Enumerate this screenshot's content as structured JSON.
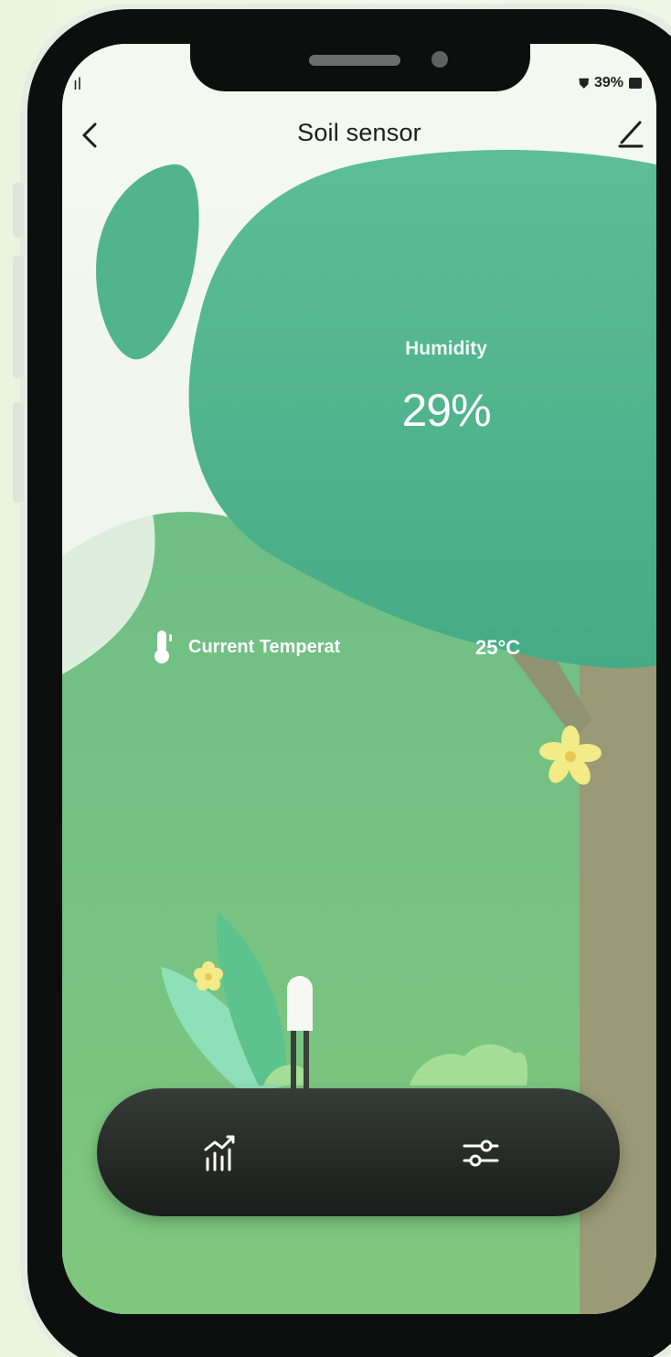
{
  "status_bar": {
    "signal": "ıl",
    "battery_text": "39%"
  },
  "header": {
    "title": "Soil sensor",
    "back_icon": "chevron-left-icon",
    "edit_icon": "pencil-icon"
  },
  "humidity": {
    "label": "Humidity",
    "value": "29%"
  },
  "temperature": {
    "icon": "thermometer-icon",
    "label": "Current Temperat",
    "value": "25°C"
  },
  "bottom_bar": {
    "history_icon": "chart-history-icon",
    "settings_icon": "sliders-icon"
  },
  "colors": {
    "canopy": "#4fb38a",
    "grass": "#7cc486",
    "trunk": "#9b9a78",
    "bar": "#1f2320"
  }
}
